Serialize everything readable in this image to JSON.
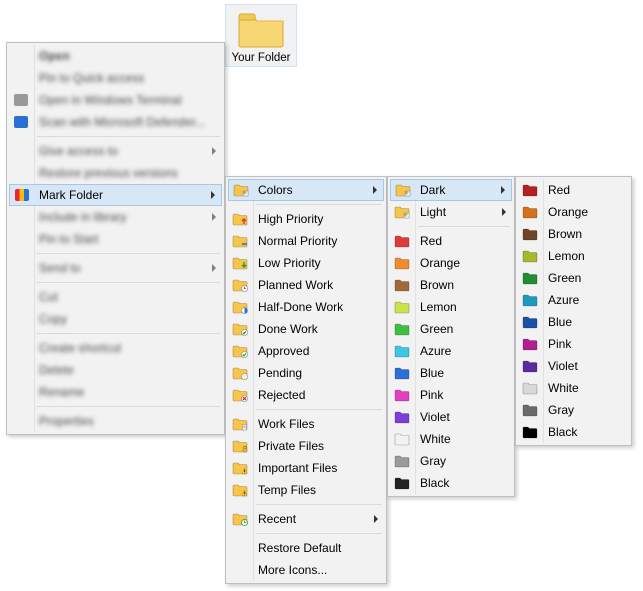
{
  "desktop": {
    "folder_label": "Your Folder"
  },
  "menu1": {
    "open": "Open",
    "pin_quick": "Pin to Quick access",
    "open_terminal": "Open in Windows Terminal",
    "scan_defender": "Scan with Microsoft Defender...",
    "give_access": "Give access to",
    "restore_versions": "Restore previous versions",
    "mark_folder": "Mark Folder",
    "include_library": "Include in library",
    "pin_start": "Pin to Start",
    "send_to": "Send to",
    "cut": "Cut",
    "copy": "Copy",
    "create_shortcut": "Create shortcut",
    "delete": "Delete",
    "rename": "Rename",
    "properties": "Properties"
  },
  "menu2": {
    "colors": "Colors",
    "high_priority": "High Priority",
    "normal_priority": "Normal Priority",
    "low_priority": "Low Priority",
    "planned_work": "Planned Work",
    "half_done": "Half-Done Work",
    "done_work": "Done Work",
    "approved": "Approved",
    "pending": "Pending",
    "rejected": "Rejected",
    "work_files": "Work Files",
    "private_files": "Private Files",
    "important_files": "Important Files",
    "temp_files": "Temp Files",
    "recent": "Recent",
    "restore_default": "Restore Default",
    "more_icons": "More Icons...",
    "icons": {
      "colors": "#f7c548",
      "high": "#f7c548",
      "normal": "#f7c548",
      "low": "#f7c548",
      "planned": "#f7c548",
      "half": "#f7c548",
      "done": "#f7c548",
      "approved": "#f7c548",
      "pending": "#f7c548",
      "rejected": "#f7c548",
      "work": "#f7c548",
      "private": "#f7c548",
      "important": "#f7c548",
      "temp": "#f7c548",
      "recent": "#f7c548"
    }
  },
  "menu3": {
    "dark": "Dark",
    "light": "Light",
    "colors": [
      {
        "label": "Red",
        "color": "#e03b3b"
      },
      {
        "label": "Orange",
        "color": "#f08c2e"
      },
      {
        "label": "Brown",
        "color": "#a06a3a"
      },
      {
        "label": "Lemon",
        "color": "#cde14a"
      },
      {
        "label": "Green",
        "color": "#3fbf3f"
      },
      {
        "label": "Azure",
        "color": "#3cc7e6"
      },
      {
        "label": "Blue",
        "color": "#2a6fd6"
      },
      {
        "label": "Pink",
        "color": "#e23fc1"
      },
      {
        "label": "Violet",
        "color": "#7a3fd6"
      },
      {
        "label": "White",
        "color": "#f2f2f2"
      },
      {
        "label": "Gray",
        "color": "#9a9a9a"
      },
      {
        "label": "Black",
        "color": "#222222"
      }
    ]
  },
  "menu4": {
    "colors": [
      {
        "label": "Red",
        "color": "#b52020"
      },
      {
        "label": "Orange",
        "color": "#d4711a"
      },
      {
        "label": "Brown",
        "color": "#6d4528"
      },
      {
        "label": "Lemon",
        "color": "#a9b82a"
      },
      {
        "label": "Green",
        "color": "#1f8f2f"
      },
      {
        "label": "Azure",
        "color": "#1f9abf"
      },
      {
        "label": "Blue",
        "color": "#1c4fa8"
      },
      {
        "label": "Pink",
        "color": "#b02092"
      },
      {
        "label": "Violet",
        "color": "#5a2aa0"
      },
      {
        "label": "White",
        "color": "#d8d8d8"
      },
      {
        "label": "Gray",
        "color": "#6a6a6a"
      },
      {
        "label": "Black",
        "color": "#000000"
      }
    ]
  }
}
